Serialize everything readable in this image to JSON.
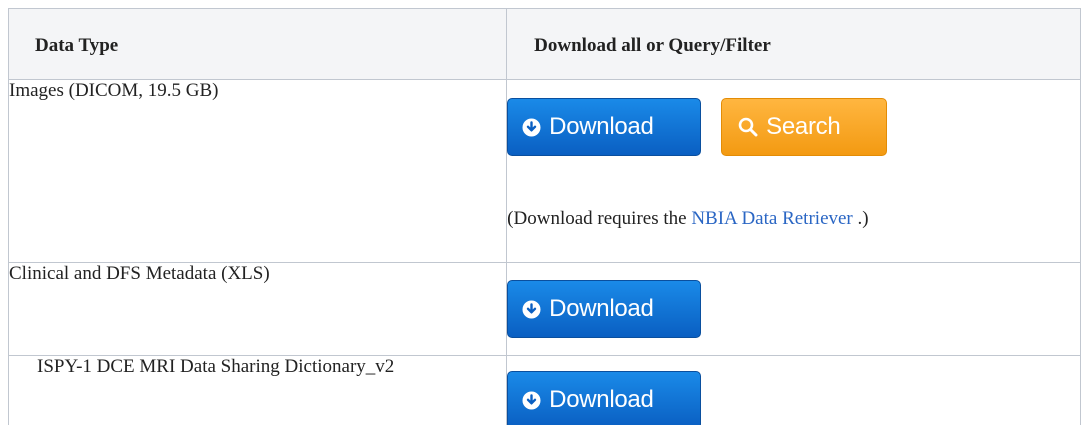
{
  "table": {
    "headers": [
      "Data Type",
      "Download all or Query/Filter"
    ],
    "rows": [
      {
        "data_type": "Images (DICOM, 19.5 GB)",
        "download_label": "Download",
        "search_label": "Search",
        "note_prefix": "(Download requires the ",
        "note_link": "NBIA Data Retriever",
        "note_suffix": " .)"
      },
      {
        "data_type": "Clinical and DFS Metadata (XLS)",
        "download_label": "Download"
      },
      {
        "data_type": "ISPY-1 DCE MRI Data Sharing Dictionary_v2",
        "download_label": "Download"
      }
    ]
  },
  "colors": {
    "download_button": "#0a6fd6",
    "search_button": "#f7a21c",
    "link": "#2a66c4",
    "header_background": "#f4f5f7",
    "border": "#c1c7d0"
  },
  "icons": {
    "download": "circle-arrow-down-icon",
    "search": "magnifier-icon"
  }
}
